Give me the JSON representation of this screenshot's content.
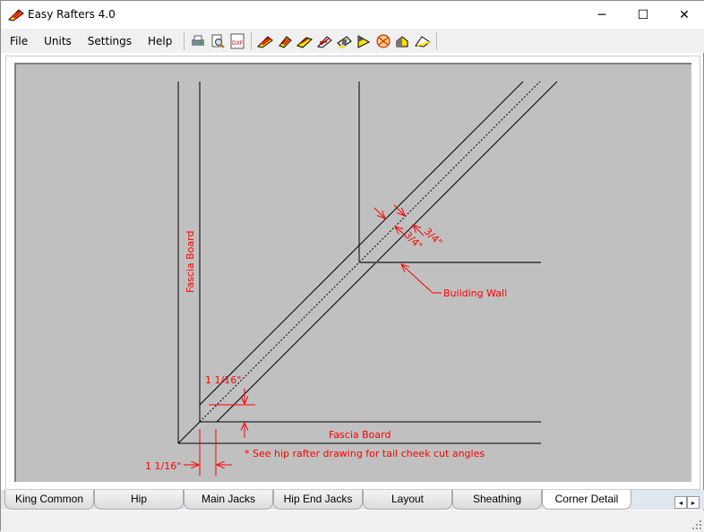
{
  "window": {
    "title": "Easy Rafters 4.0",
    "minimize": "─",
    "maximize": "☐",
    "close": "✕"
  },
  "menu": [
    {
      "label": "File"
    },
    {
      "label": "Units"
    },
    {
      "label": "Settings"
    },
    {
      "label": "Help"
    }
  ],
  "toolbar": [
    {
      "icon": "print-icon"
    },
    {
      "icon": "print-preview-icon"
    },
    {
      "icon": "dxf-export-icon",
      "label": "DXF"
    },
    {
      "icon": "king-common-icon"
    },
    {
      "icon": "hip-icon"
    },
    {
      "icon": "main-jacks-icon"
    },
    {
      "icon": "hip-end-jacks-icon"
    },
    {
      "icon": "layout-icon"
    },
    {
      "icon": "sheathing-icon"
    },
    {
      "icon": "corner-detail-icon"
    },
    {
      "icon": "roof-icon"
    },
    {
      "icon": "gable-icon"
    }
  ],
  "drawing": {
    "fascia_vertical": "Fascia Board",
    "fascia_horizontal": "Fascia Board",
    "dim_top": "1 1/16\"",
    "dim_bottom": "1 1/16\"",
    "dim_a": "3/4\"",
    "dim_b": "3/4\"",
    "building_wall": "Building Wall",
    "note": "* See hip rafter drawing for tail cheek cut angles",
    "annotation_color": "#ff0000"
  },
  "tabs": [
    {
      "label": "King Common"
    },
    {
      "label": "Hip"
    },
    {
      "label": "Main Jacks"
    },
    {
      "label": "Hip End Jacks"
    },
    {
      "label": "Layout"
    },
    {
      "label": "Sheathing"
    },
    {
      "label": "Corner Detail",
      "active": true
    }
  ],
  "tab_scroll": {
    "left": "◂",
    "right": "▸"
  }
}
